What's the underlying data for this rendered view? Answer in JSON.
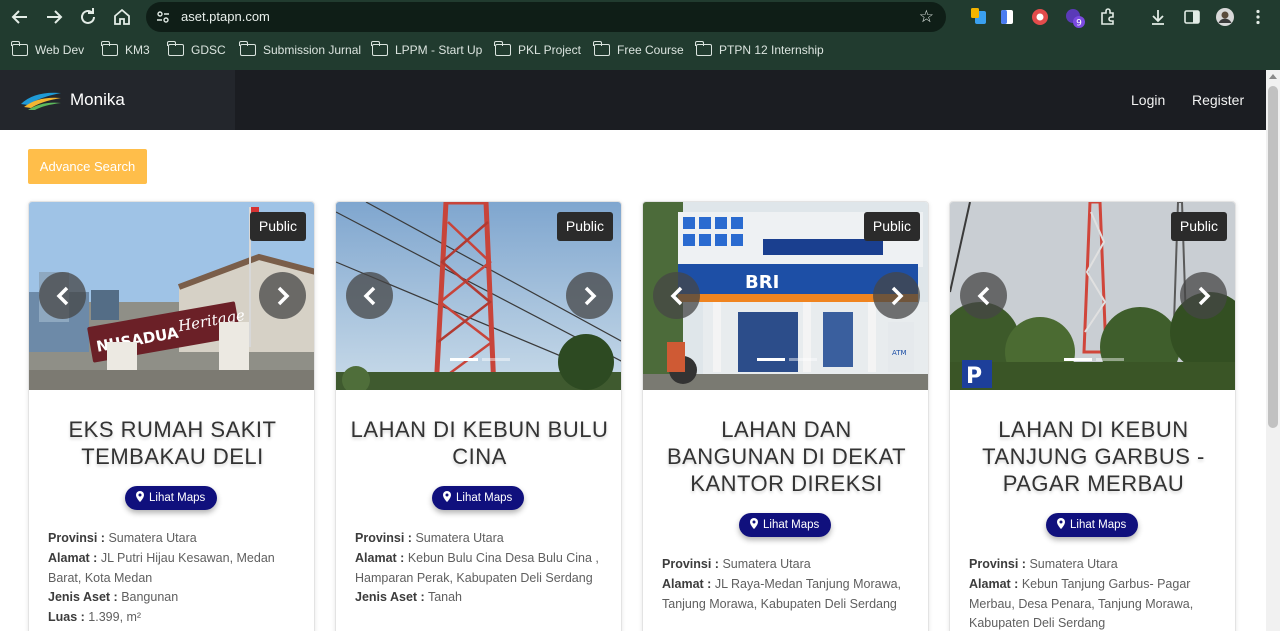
{
  "browser": {
    "url": "aset.ptapn.com",
    "ext_badge": "9",
    "bookmarks": [
      "Web Dev",
      "KM3",
      "GDSC",
      "Submission Jurnal",
      "LPPM - Start Up",
      "PKL Project",
      "Free Course",
      "PTPN 12 Internship"
    ]
  },
  "header": {
    "brand": "Monika",
    "nav": {
      "login": "Login",
      "register": "Register"
    }
  },
  "advance_search_label": "Advance Search",
  "cards": [
    {
      "badge": "Public",
      "title": "EKS RUMAH SAKIT TEMBAKAU DELI",
      "maps_label": "Lihat Maps",
      "provinsi_label": "Provinsi :",
      "provinsi": "Sumatera Utara",
      "alamat_label": "Alamat :",
      "alamat": "JL Putri Hijau Kesawan, Medan Barat, Kota Medan",
      "jenis_label": "Jenis Aset :",
      "jenis": "Bangunan",
      "luas_label": "Luas :",
      "luas": "1.399, m²",
      "sign_text": "NUSADUA",
      "sign_script": "Heritage"
    },
    {
      "badge": "Public",
      "title": "LAHAN DI KEBUN BULU CINA",
      "maps_label": "Lihat Maps",
      "provinsi_label": "Provinsi :",
      "provinsi": "Sumatera Utara",
      "alamat_label": "Alamat :",
      "alamat": "Kebun Bulu Cina Desa Bulu Cina , Hamparan Perak, Kabupaten Deli Serdang",
      "jenis_label": "Jenis Aset :",
      "jenis": "Tanah"
    },
    {
      "badge": "Public",
      "title": "LAHAN DAN BANGUNAN DI DEKAT KANTOR DIREKSI",
      "maps_label": "Lihat Maps",
      "provinsi_label": "Provinsi :",
      "provinsi": "Sumatera Utara",
      "alamat_label": "Alamat :",
      "alamat": "JL Raya-Medan Tanjung Morawa, Tanjung Morawa, Kabupaten Deli Serdang",
      "sign_text": "BRI",
      "atm_text": "ATM"
    },
    {
      "badge": "Public",
      "title": "LAHAN DI KEBUN TANJUNG GARBUS - PAGAR MERBAU",
      "maps_label": "Lihat Maps",
      "provinsi_label": "Provinsi :",
      "provinsi": "Sumatera Utara",
      "alamat_label": "Alamat :",
      "alamat": "Kebun Tanjung Garbus- Pagar Merbau, Desa Penara, Tanjung Morawa, Kabupaten Deli Serdang",
      "sign_text": "P"
    }
  ]
}
